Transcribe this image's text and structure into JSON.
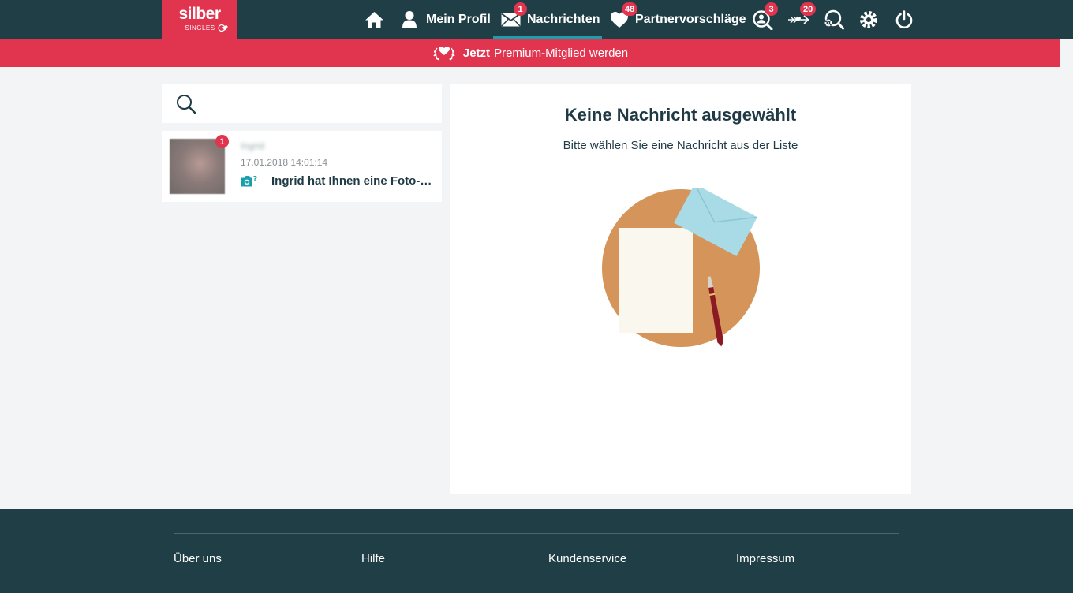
{
  "logo": {
    "line1": "silber",
    "line2": "SINGLES"
  },
  "nav": {
    "home_label": "",
    "profile_label": "Mein Profil",
    "messages_label": "Nachrichten",
    "messages_badge": "1",
    "suggestions_label": "Partnervorschläge",
    "suggestions_badge": "48",
    "visitors_badge": "3",
    "cupid_badge": "20"
  },
  "premium": {
    "strong": "Jetzt",
    "text": "Premium-Mitglied werden"
  },
  "search": {
    "placeholder": ""
  },
  "messages": [
    {
      "name": "Ingrid",
      "time": "17.01.2018 14:01:14",
      "preview": "Ingrid hat Ihnen eine Foto-Anfrage gesendet",
      "badge": "1"
    }
  ],
  "detail": {
    "title": "Keine Nachricht ausgewählt",
    "subtitle": "Bitte wählen Sie eine Nachricht aus der Liste"
  },
  "footer": {
    "links": [
      "Über uns",
      "Hilfe",
      "Kundenservice",
      "Impressum"
    ]
  },
  "colors": {
    "header": "#1f3e46",
    "accent": "#e0344f",
    "teal": "#1aa0ad"
  }
}
